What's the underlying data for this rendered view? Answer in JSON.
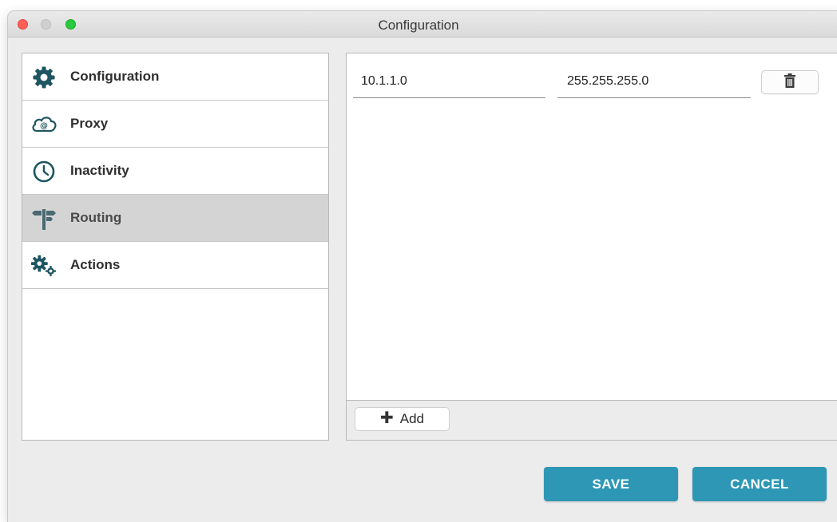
{
  "window": {
    "title": "Configuration"
  },
  "colors": {
    "accent": "#2d97b5",
    "icon": "#1d5560",
    "selected_bg": "#d4d4d4"
  },
  "sidebar": {
    "items": [
      {
        "label": "Configuration",
        "icon": "gear-icon",
        "selected": false
      },
      {
        "label": "Proxy",
        "icon": "cloud-at-icon",
        "selected": false
      },
      {
        "label": "Inactivity",
        "icon": "clock-icon",
        "selected": false
      },
      {
        "label": "Routing",
        "icon": "signpost-icon",
        "selected": true
      },
      {
        "label": "Actions",
        "icon": "gears-icon",
        "selected": false
      }
    ]
  },
  "routing": {
    "routes": [
      {
        "network": "10.1.1.0",
        "netmask": "255.255.255.0"
      }
    ],
    "add_label": "Add"
  },
  "footer": {
    "save_label": "SAVE",
    "cancel_label": "CANCEL"
  }
}
